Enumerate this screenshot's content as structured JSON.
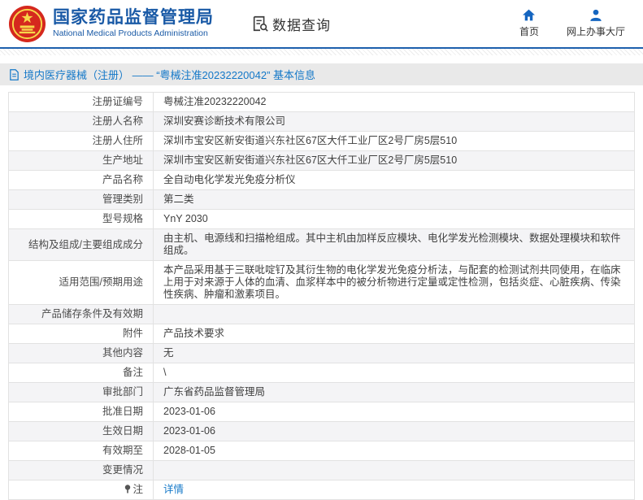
{
  "colors": {
    "brand_blue": "#1a5aa6",
    "rule_blue": "#1d60ad",
    "link_blue": "#1478c8",
    "nav_icon_blue": "#1565c0",
    "emblem_red": "#d5281e",
    "row_alt_gray": "#f4f4f6",
    "bar_gray": "#e9e9e9"
  },
  "header": {
    "brand_title": "国家药品监督管理局",
    "brand_subtitle": "National Medical Products Administration",
    "section_label": "数据查询",
    "nav": [
      {
        "label": "首页",
        "icon": "home-icon"
      },
      {
        "label": "网上办事大厅",
        "icon": "user-icon"
      }
    ]
  },
  "breadcrumb": {
    "text": "境内医疗器械（注册） —— “粤械注准20232220042” 基本信息"
  },
  "table": {
    "rows": [
      {
        "label": "注册证编号",
        "value": "粤械注准20232220042"
      },
      {
        "label": "注册人名称",
        "value": "深圳安赛诊断技术有限公司"
      },
      {
        "label": "注册人住所",
        "value": "深圳市宝安区新安街道兴东社区67区大仟工业厂区2号厂房5层510"
      },
      {
        "label": "生产地址",
        "value": "深圳市宝安区新安街道兴东社区67区大仟工业厂区2号厂房5层510"
      },
      {
        "label": "产品名称",
        "value": "全自动电化学发光免疫分析仪"
      },
      {
        "label": "管理类别",
        "value": "第二类"
      },
      {
        "label": "型号规格",
        "value": "YnY 2030"
      },
      {
        "label": "结构及组成/主要组成成分",
        "value": "由主机、电源线和扫描枪组成。其中主机由加样反应模块、电化学发光检测模块、数据处理模块和软件组成。"
      },
      {
        "label": "适用范围/预期用途",
        "value": "本产品采用基于三联吡啶钌及其衍生物的电化学发光免疫分析法，与配套的检测试剂共同使用，在临床上用于对来源于人体的血清、血浆样本中的被分析物进行定量或定性检测，包括炎症、心脏疾病、传染性疾病、肿瘤和激素项目。"
      },
      {
        "label": "产品储存条件及有效期",
        "value": ""
      },
      {
        "label": "附件",
        "value": "产品技术要求"
      },
      {
        "label": "其他内容",
        "value": "无"
      },
      {
        "label": "备注",
        "value": "\\"
      },
      {
        "label": "审批部门",
        "value": "广东省药品监督管理局"
      },
      {
        "label": "批准日期",
        "value": "2023-01-06"
      },
      {
        "label": "生效日期",
        "value": "2023-01-06"
      },
      {
        "label": "有效期至",
        "value": "2028-01-05"
      },
      {
        "label": "变更情况",
        "value": ""
      },
      {
        "label": "注",
        "value": "详情",
        "link": true,
        "label_icon": "note-pin-icon"
      }
    ]
  }
}
